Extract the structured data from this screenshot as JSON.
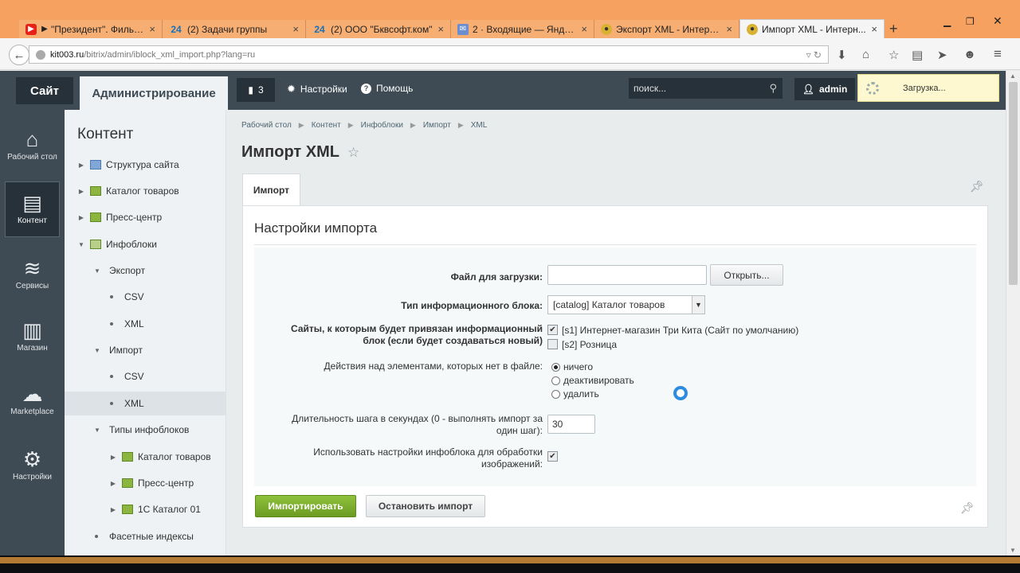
{
  "browser": {
    "tabs": [
      {
        "label": "\"Президент\". Фильм ...",
        "icon": "youtube-icon"
      },
      {
        "label": "(2) Задачи группы",
        "icon": "bitrix24-icon"
      },
      {
        "label": "(2) ООО \"Бквсофт.ком\"",
        "icon": "bitrix24-icon"
      },
      {
        "label": "2 · Входящие — Яндекс...",
        "icon": "mail-icon"
      },
      {
        "label": "Экспорт XML - Интерн...",
        "icon": "site-icon"
      },
      {
        "label": "Импорт XML - Интерн...",
        "icon": "site-icon"
      }
    ],
    "new_tab": "+",
    "url_host": "kit003.ru",
    "url_path": "/bitrix/admin/iblock_xml_import.php?lang=ru"
  },
  "panel": {
    "site": "Сайт",
    "admin": "Администрирование",
    "notify_count": "3",
    "settings": "Настройки",
    "help": "Помощь",
    "search_placeholder": "поиск...",
    "user": "admin",
    "loading": "Загрузка..."
  },
  "leftmenu": [
    {
      "label": "Рабочий стол",
      "icon": "home-icon"
    },
    {
      "label": "Контент",
      "icon": "document-icon"
    },
    {
      "label": "Сервисы",
      "icon": "layers-icon"
    },
    {
      "label": "Магазин",
      "icon": "basket-icon"
    },
    {
      "label": "Marketplace",
      "icon": "cloud-download-icon"
    },
    {
      "label": "Настройки",
      "icon": "gear-icon"
    }
  ],
  "tree": {
    "title": "Контент",
    "items": [
      {
        "label": "Структура сайта"
      },
      {
        "label": "Каталог товаров"
      },
      {
        "label": "Пресс-центр"
      },
      {
        "label": "Инфоблоки"
      },
      {
        "label": "Экспорт"
      },
      {
        "label": "CSV"
      },
      {
        "label": "XML"
      },
      {
        "label": "Импорт"
      },
      {
        "label": "CSV"
      },
      {
        "label": "XML"
      },
      {
        "label": "Типы инфоблоков"
      },
      {
        "label": "Каталог товаров"
      },
      {
        "label": "Пресс-центр"
      },
      {
        "label": "1С Каталог 01"
      },
      {
        "label": "Фасетные индексы"
      }
    ]
  },
  "breadcrumb": [
    "Рабочий стол",
    "Контент",
    "Инфоблоки",
    "Импорт",
    "XML"
  ],
  "page_title": "Импорт XML",
  "tab_label": "Импорт",
  "form": {
    "title": "Настройки импорта",
    "file_label": "Файл для загрузки:",
    "file_value": "",
    "open_button": "Открыть...",
    "type_label": "Тип информационного блока:",
    "type_value": "[catalog] Каталог товаров",
    "sites_label": "Сайты, к которым будет привязан информационный блок (если будет создаваться новый)",
    "site1": "[s1] Интернет-магазин Три Кита (Сайт по умолчанию)",
    "site2": "[s2] Розница",
    "action_label": "Действия над элементами, которых нет в файле:",
    "action_none": "ничего",
    "action_deactivate": "деактивировать",
    "action_delete": "удалить",
    "step_label": "Длительность шага в секундах (0 - выполнять импорт за один шаг):",
    "step_value": "30",
    "img_label": "Использовать настройки инфоблока для обработки изображений:",
    "import_button": "Импортировать",
    "stop_button": "Остановить импорт"
  }
}
